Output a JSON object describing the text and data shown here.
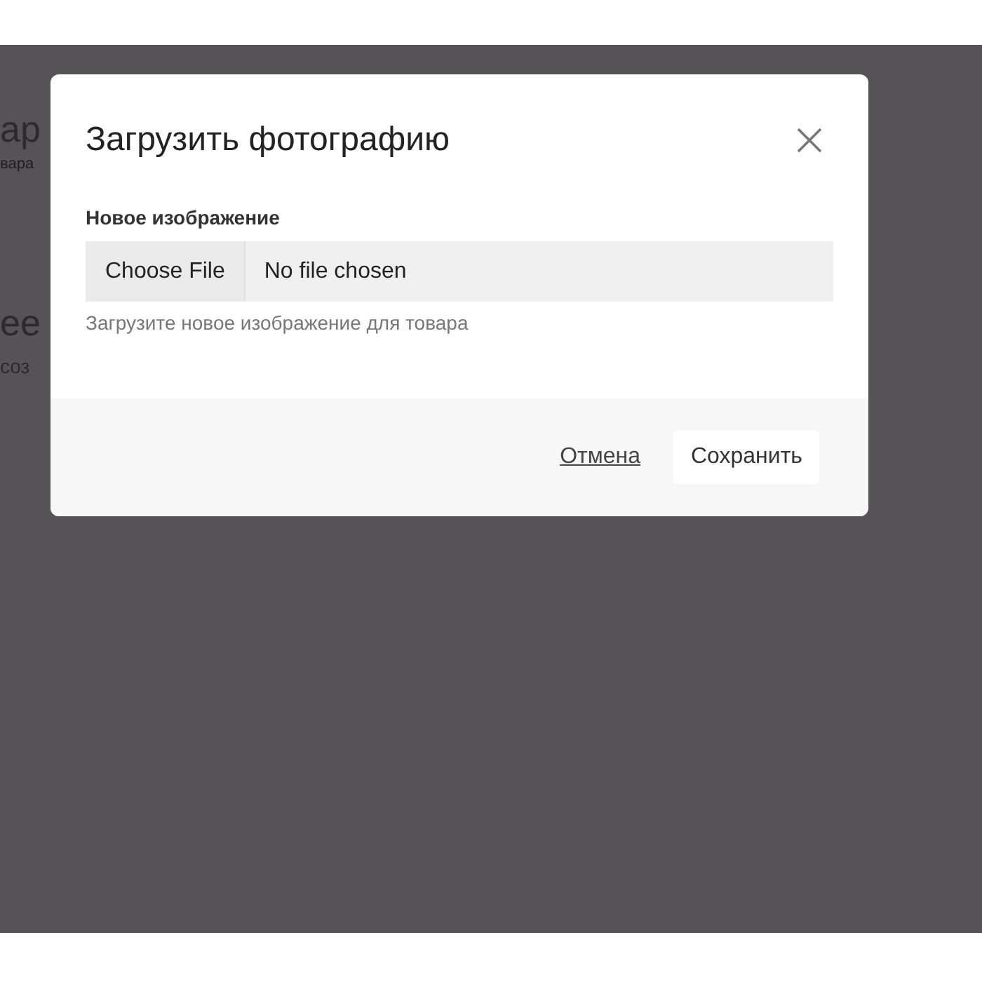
{
  "background_page": {
    "heading": "ар",
    "subheading": "вара",
    "section_title": "ее",
    "section_text": "соз"
  },
  "dialog": {
    "title": "Загрузить фотографию",
    "field_label": "Новое изображение",
    "file_input": {
      "button": "Choose File",
      "value": "No file chosen"
    },
    "help_text": "Загрузите новое изображение для товара",
    "buttons": [
      {
        "kind": "link",
        "label": "Отмена"
      },
      {
        "kind": "primary",
        "label": "Сохранить"
      }
    ]
  }
}
